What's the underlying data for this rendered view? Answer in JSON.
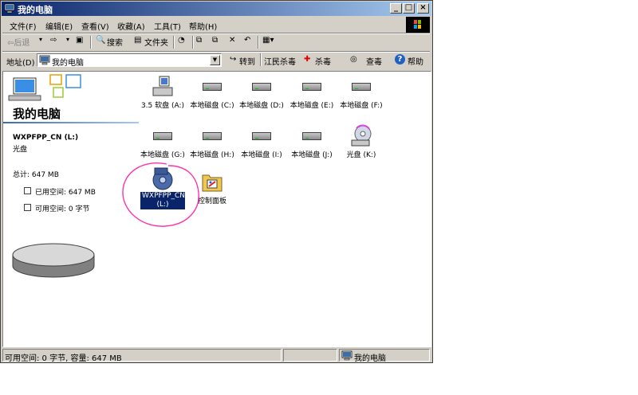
{
  "window": {
    "title": "我的电脑"
  },
  "menu": [
    "文件(F)",
    "编辑(E)",
    "查看(V)",
    "收藏(A)",
    "工具(T)",
    "帮助(H)"
  ],
  "toolbar": {
    "back": "⇦后退",
    "forward": "⇨",
    "search": "搜索",
    "folders": "文件夹"
  },
  "address": {
    "label": "地址(D)",
    "value": "我的电脑",
    "go": "转到",
    "links": [
      "江民杀毒",
      "杀毒",
      "查毒",
      "帮助"
    ]
  },
  "left_panel": {
    "title": "我的电脑",
    "drive_name": "WXPFPP_CN (L:)",
    "drive_type": "光盘",
    "total": "总计: 647 MB",
    "used": "已用空间: 647 MB",
    "free": "可用空间: 0 字节",
    "used_fraction": 1.0
  },
  "items": [
    {
      "label": "3.5 软盘 (A:)",
      "icon": "floppy-drive-icon"
    },
    {
      "label": "本地磁盘 (C:)",
      "icon": "hard-drive-icon"
    },
    {
      "label": "本地磁盘 (D:)",
      "icon": "hard-drive-icon"
    },
    {
      "label": "本地磁盘 (E:)",
      "icon": "hard-drive-icon"
    },
    {
      "label": "本地磁盘 (F:)",
      "icon": "hard-drive-icon"
    },
    {
      "label": "本地磁盘 (G:)",
      "icon": "hard-drive-icon"
    },
    {
      "label": "本地磁盘 (H:)",
      "icon": "hard-drive-icon"
    },
    {
      "label": "本地磁盘 (I:)",
      "icon": "hard-drive-icon"
    },
    {
      "label": "本地磁盘 (J:)",
      "icon": "hard-drive-icon"
    },
    {
      "label": "光盘 (K:)",
      "icon": "cd-drive-icon"
    },
    {
      "label": "WXPFPP_CN (L:)",
      "icon": "cd-media-icon"
    },
    {
      "label": "控制面板",
      "icon": "control-panel-icon"
    }
  ],
  "status": {
    "left": "可用空间: 0 字节, 容量: 647 MB",
    "right": "我的电脑"
  },
  "colors": {
    "title_blue": "#0a246a",
    "face": "#d4d0c8",
    "annotation": "#ff33aa"
  }
}
